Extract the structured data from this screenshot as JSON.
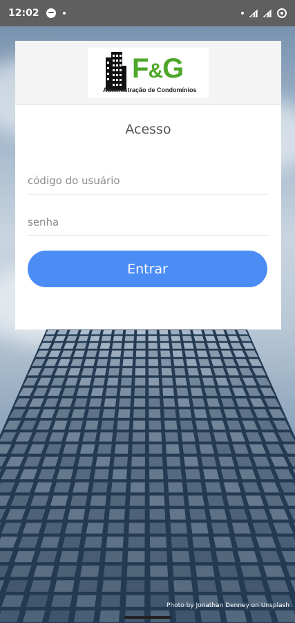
{
  "status_bar": {
    "time": "12:02",
    "icons": [
      "spotify-icon",
      "notification-dot-icon",
      "signal-icon",
      "signal-icon",
      "sync-icon"
    ]
  },
  "logo": {
    "brand": "F&G",
    "brand_f": "F",
    "brand_amp": "&",
    "brand_g": "G",
    "subtitle": "Administração de Condomínios"
  },
  "login": {
    "title": "Acesso",
    "user_placeholder": "código do usuário",
    "password_placeholder": "senha",
    "submit_label": "Entrar"
  },
  "credit": {
    "prefix": "Photo by",
    "author": "Jonathan Denney",
    "on": "on",
    "site": "Unsplash"
  },
  "colors": {
    "accent": "#4c8df5",
    "brand_green": "#4ea62a",
    "status_bar": "#5f5f5f"
  }
}
